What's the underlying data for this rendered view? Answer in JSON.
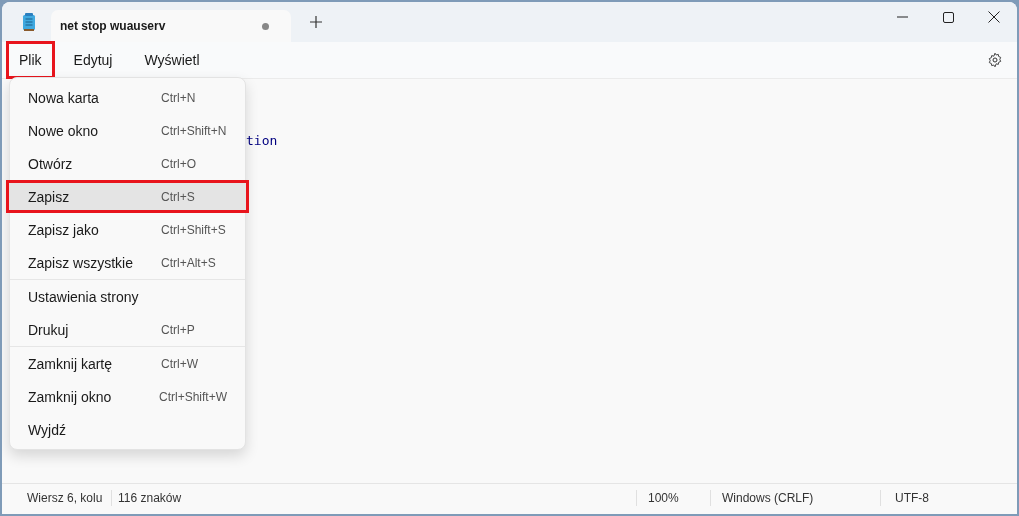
{
  "window": {
    "tab": {
      "title": "net stop wuauserv",
      "modified": true
    }
  },
  "menu_bar": [
    {
      "label": "Plik",
      "highlighted": true
    },
    {
      "label": "Edytuj",
      "highlighted": false
    },
    {
      "label": "Wyświetl",
      "highlighted": false
    }
  ],
  "editor": {
    "visible_text": "tion"
  },
  "file_menu": {
    "groups": [
      [
        {
          "label": "Nowa karta",
          "shortcut": "Ctrl+N",
          "highlighted": false,
          "hovered": false
        },
        {
          "label": "Nowe okno",
          "shortcut": "Ctrl+Shift+N",
          "highlighted": false,
          "hovered": false
        },
        {
          "label": "Otwórz",
          "shortcut": "Ctrl+O",
          "highlighted": false,
          "hovered": false
        },
        {
          "label": "Zapisz",
          "shortcut": "Ctrl+S",
          "highlighted": true,
          "hovered": true
        },
        {
          "label": "Zapisz jako",
          "shortcut": "Ctrl+Shift+S",
          "highlighted": false,
          "hovered": false
        },
        {
          "label": "Zapisz wszystkie",
          "shortcut": "Ctrl+Alt+S",
          "highlighted": false,
          "hovered": false
        }
      ],
      [
        {
          "label": "Ustawienia strony",
          "highlighted": false,
          "hovered": false
        },
        {
          "label": "Drukuj",
          "shortcut": "Ctrl+P",
          "highlighted": false,
          "hovered": false
        }
      ],
      [
        {
          "label": "Zamknij kartę",
          "shortcut": "Ctrl+W",
          "highlighted": false,
          "hovered": false
        },
        {
          "label": "Zamknij okno",
          "shortcut": "Ctrl+Shift+W",
          "highlighted": false,
          "hovered": false
        },
        {
          "label": "Wyjdź",
          "highlighted": false,
          "hovered": false
        }
      ]
    ]
  },
  "status_bar": [
    "Wiersz 6, kolu",
    "116 znaków",
    "100%",
    "Windows (CRLF)",
    "UTF-8"
  ]
}
